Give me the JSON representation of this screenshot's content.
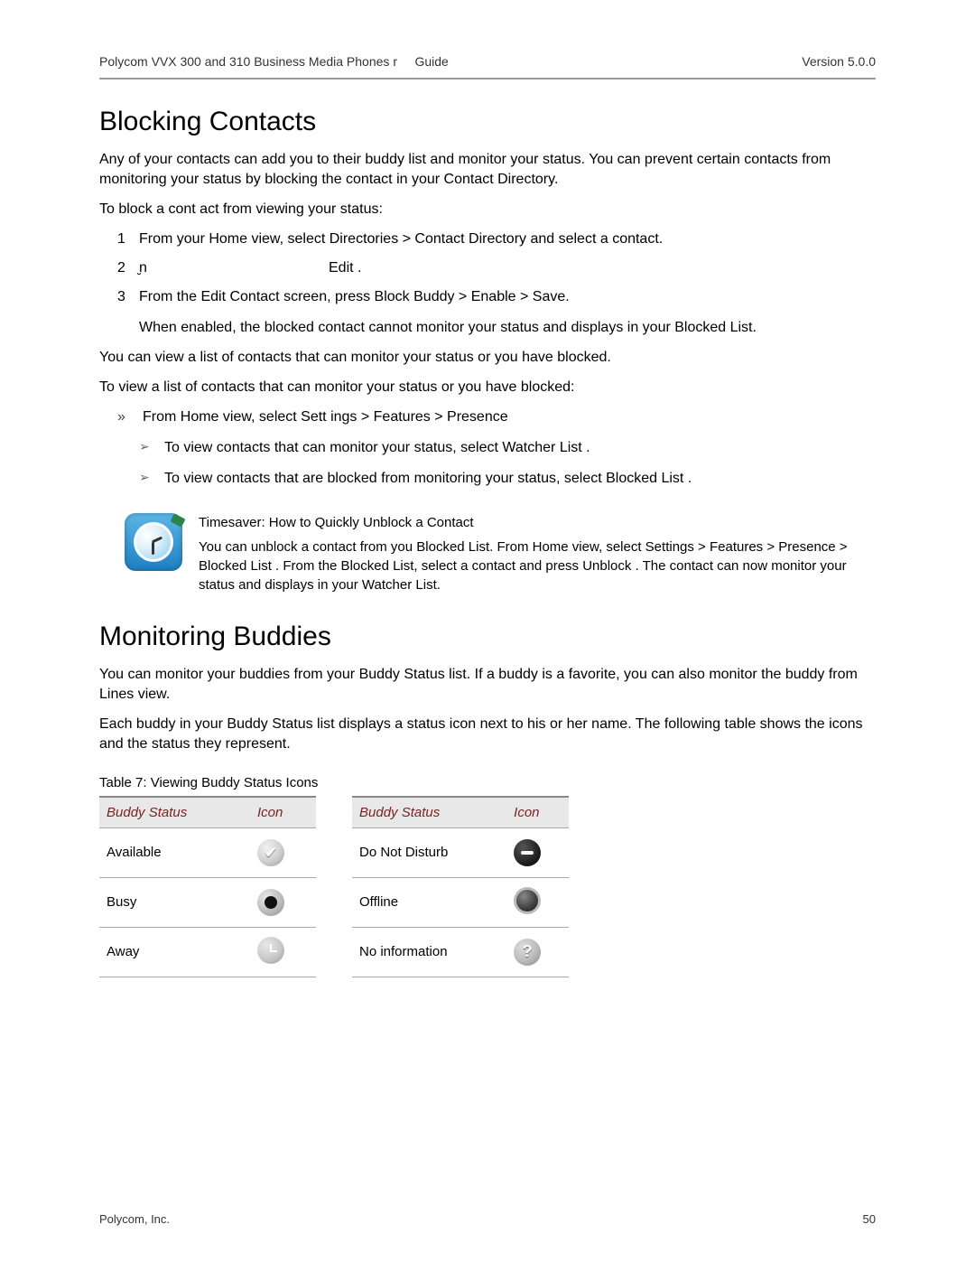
{
  "header": {
    "title_left": "Polycom VVX 300 and 310 Business Media Phones",
    "title_mid_fragment": "r",
    "version_label": "Version 5.0.0",
    "guide_label": "Guide"
  },
  "section1": {
    "title": "Blocking Contacts",
    "intro": "Any of your contacts can add you to their buddy list and monitor your status. You can prevent certain contacts from monitoring your status by blocking the contact in your Contact Directory.",
    "to_block": "To block a cont  act from viewing your status:",
    "steps": [
      {
        "n": "1",
        "text": "From your Home view, select Directories  > Contact Directory   and select a contact."
      },
      {
        "n": "2",
        "text_a": "̮n",
        "text_b": "Edit ."
      },
      {
        "n": "3",
        "text": "From the Edit Contact screen, press Block Buddy  > Enable  > Save.",
        "note": "When enabled, the blocked contact cannot monitor your status and displays in your Blocked List."
      }
    ],
    "can_view": "You can view a list of contacts that can monitor your status or you have blocked.",
    "to_view": "To view a list of contacts that can monitor your status or you have blocked:",
    "bullet_main": "From Home view, select Sett ings  > Features  > Presence",
    "sub_bullets": [
      "To view contacts that can monitor your status, select Watcher List  .",
      "To view contacts that are blocked from monitoring your status, select Blocked List  ."
    ]
  },
  "callout": {
    "title": "Timesaver:  How to Quickly Unblock a Contact",
    "body": "You can unblock a contact from you Blocked List. From Home view, select Settings  > Features  > Presence  > Blocked List  . From the Blocked List, select a contact and press Unblock . The contact can now monitor your status and displays in your Watcher List."
  },
  "section2": {
    "title": "Monitoring Buddies",
    "p1": "You can monitor your buddies from your Buddy Status list. If a buddy is a favorite, you can also monitor the buddy from Lines view.",
    "p2": "Each buddy in your Buddy Status list displays a status icon next to his or her name. The following table shows the icons and the status they represent.",
    "table_caption": "Table 7: Viewing Buddy Status Icons",
    "columns": {
      "status": "Buddy Status",
      "icon": "Icon"
    },
    "left": [
      {
        "status": "Available",
        "icon": "available"
      },
      {
        "status": "Busy",
        "icon": "busy"
      },
      {
        "status": "Away",
        "icon": "away"
      }
    ],
    "right": [
      {
        "status": "Do Not Disturb",
        "icon": "dnd"
      },
      {
        "status": "Offline",
        "icon": "offline"
      },
      {
        "status": "No information",
        "icon": "noinfo"
      }
    ]
  },
  "footer": {
    "company": "Polycom, Inc.",
    "page": "50"
  }
}
